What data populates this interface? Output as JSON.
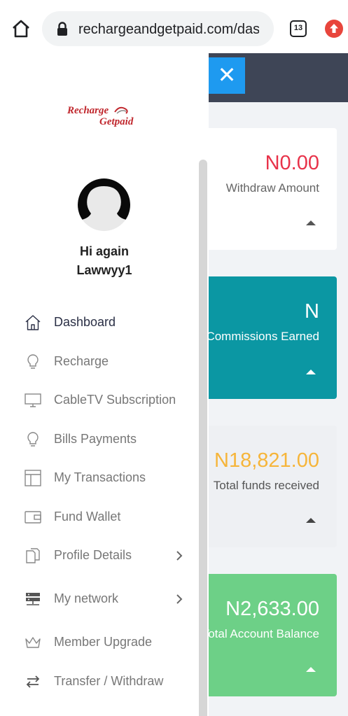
{
  "browser": {
    "url": "rechargeandgetpaid.com/dash",
    "tab_count": "13"
  },
  "logo": {
    "line1": "Recharge",
    "line2": "Getpaid"
  },
  "user": {
    "greeting": "Hi again",
    "name": "Lawwyy1"
  },
  "close_icon": "✕",
  "menu": [
    {
      "label": "Dashboard",
      "icon": "home-icon",
      "active": true
    },
    {
      "label": "Recharge",
      "icon": "lightbulb-icon"
    },
    {
      "label": "CableTV Subscription",
      "icon": "monitor-icon"
    },
    {
      "label": "Bills Payments",
      "icon": "lightbulb-icon"
    },
    {
      "label": "My Transactions",
      "icon": "layout-icon"
    },
    {
      "label": "Fund Wallet",
      "icon": "wallet-icon"
    },
    {
      "label": "Profile Details",
      "icon": "documents-icon",
      "has_submenu": true
    },
    {
      "label": "My network",
      "icon": "server-icon",
      "has_submenu": true
    },
    {
      "label": "Member Upgrade",
      "icon": "crown-icon"
    },
    {
      "label": "Transfer / Withdraw",
      "icon": "transfer-icon"
    }
  ],
  "cards": [
    {
      "amount": "N0.00",
      "label": "Withdraw Amount",
      "color": "#e8334a"
    },
    {
      "amount": "N",
      "label": "Commissions Earned",
      "color": "#0b97a3"
    },
    {
      "amount": "N18,821.00",
      "label": "Total funds received",
      "color": "#f6b53a"
    },
    {
      "amount": "N2,633.00",
      "label": "Total Account Balance",
      "color": "#6dd087"
    }
  ]
}
